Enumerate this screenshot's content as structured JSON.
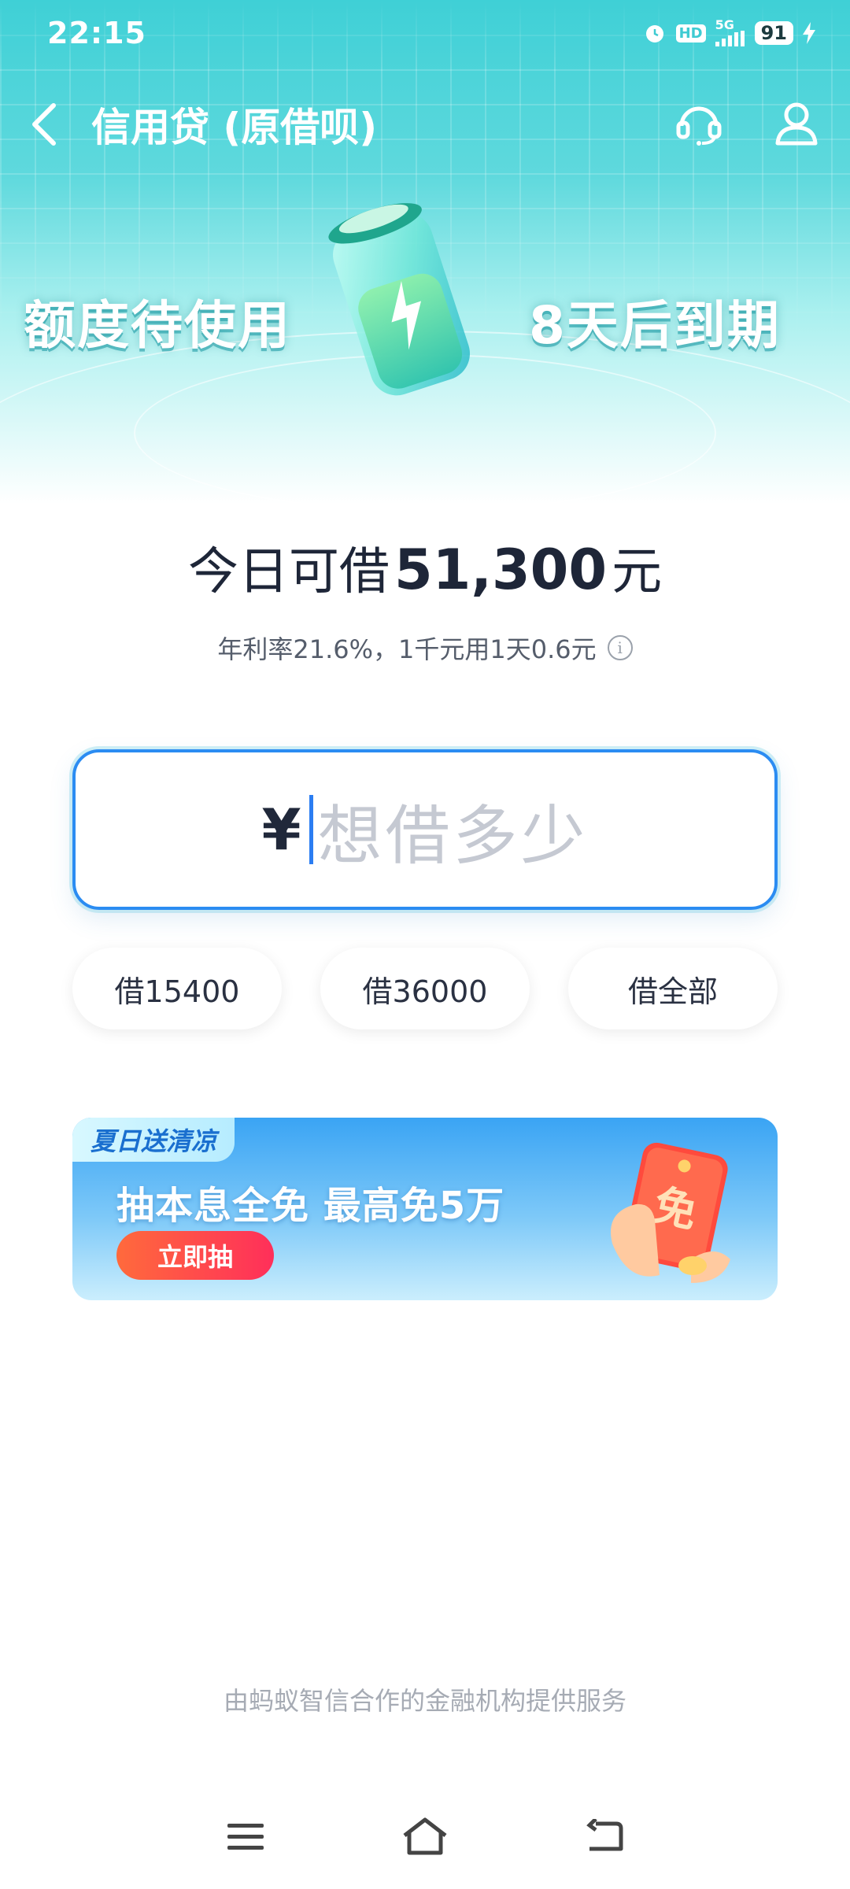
{
  "status_bar": {
    "time": "22:15",
    "hd": "HD",
    "network": "5G",
    "battery": "91"
  },
  "nav": {
    "title": "信用贷 (原借呗)",
    "back_icon": "chevron-left-icon",
    "service_icon": "headset-icon",
    "profile_icon": "person-icon"
  },
  "hero": {
    "left_text": "额度待使用",
    "right_text": "8天后到期"
  },
  "available": {
    "prefix": "今日可借",
    "amount": "51,300",
    "suffix": "元"
  },
  "rate_text": "年利率21.6%，1千元用1天0.6元",
  "input": {
    "currency": "¥",
    "placeholder": "想借多少"
  },
  "chips": [
    {
      "label": "借15400"
    },
    {
      "label": "借36000"
    },
    {
      "label": "借全部"
    }
  ],
  "banner": {
    "tag": "夏日送清凉",
    "title": "抽本息全免 最高免5万",
    "button": "立即抽",
    "art_text": "免"
  },
  "footer": "由蚂蚁智信合作的金融机构提供服务",
  "colors": {
    "accent_blue": "#2b8cf2",
    "hero_teal": "#3fd0d6",
    "banner_button": "#ff2f5a"
  }
}
